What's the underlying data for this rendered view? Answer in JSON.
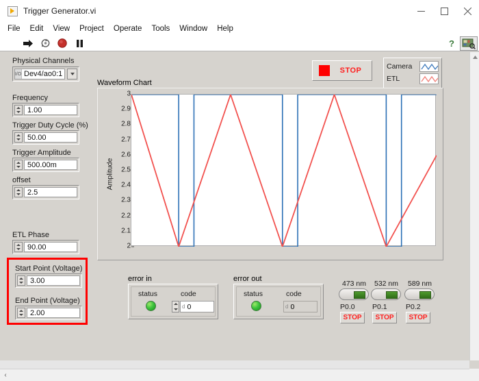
{
  "window": {
    "title": "Trigger Generator.vi",
    "icon": "vi-front-panel-icon",
    "minimize": "─",
    "maximize": "□",
    "close": "✕"
  },
  "menu": {
    "items": [
      "File",
      "Edit",
      "View",
      "Project",
      "Operate",
      "Tools",
      "Window",
      "Help"
    ]
  },
  "toolbar": {
    "buttons": [
      {
        "name": "run-button",
        "icon": "right-arrow-icon"
      },
      {
        "name": "run-continuously-button",
        "icon": "circular-arrows-icon"
      },
      {
        "name": "abort-execution-button",
        "icon": "stop-circle-icon"
      },
      {
        "name": "pause-button",
        "icon": "pause-icon"
      }
    ],
    "help_glyph": "?",
    "search_icon": "search-panel-icon"
  },
  "controls": {
    "physical_channels": {
      "label": "Physical Channels",
      "value": "Dev4/ao0:1",
      "glyph": "io-name-icon"
    },
    "frequency": {
      "label": "Frequency",
      "value": "1.00"
    },
    "duty_cycle": {
      "label": "Trigger Duty Cycle (%)",
      "value": "50.00"
    },
    "amplitude": {
      "label": "Trigger Amplitude",
      "value": "500.00m"
    },
    "offset": {
      "label": "offset",
      "value": "2.5"
    },
    "etl_phase": {
      "label": "ETL Phase",
      "value": "90.00"
    },
    "start_point": {
      "label": "Start Point (Voltage)",
      "value": "3.00"
    },
    "end_point": {
      "label": "End Point (Voltage)",
      "value": "2.00"
    }
  },
  "stop_button": {
    "label": "STOP",
    "color": "#ff2020",
    "indicator_color": "#ff0000"
  },
  "chart": {
    "title": "Waveform Chart",
    "legend": [
      {
        "name": "Camera",
        "color": "#2a6fb5"
      },
      {
        "name": "ETL",
        "color": "#f2514e"
      }
    ]
  },
  "chart_data": {
    "type": "line",
    "title": "Waveform Chart",
    "xlabel": "",
    "ylabel": "Amplitude",
    "ylim": [
      2,
      3
    ],
    "yticks": [
      3,
      2.9,
      2.8,
      2.7,
      2.6,
      2.5,
      2.4,
      2.3,
      2.2,
      2.1,
      2
    ],
    "ytick_labels": [
      "3",
      "2.9",
      "2.8",
      "2.7",
      "2.6",
      "2.5",
      "2.4",
      "2.3",
      "2.2",
      "2.1",
      "2"
    ],
    "xlim": [
      0,
      100
    ],
    "xticks": [],
    "grid": false,
    "legend_position": "outside-top-right",
    "series": [
      {
        "name": "Camera",
        "color": "#2a6fb5",
        "type": "square",
        "description": "Camera trigger square wave, high at 3 V, drops to 2 V at each ETL trough",
        "points": [
          [
            0,
            3
          ],
          [
            15.5,
            3
          ],
          [
            15.5,
            2
          ],
          [
            20.5,
            2
          ],
          [
            20.5,
            3
          ],
          [
            49.5,
            3
          ],
          [
            49.5,
            2
          ],
          [
            54.5,
            2
          ],
          [
            54.5,
            3
          ],
          [
            83.5,
            3
          ],
          [
            83.5,
            2
          ],
          [
            88.5,
            2
          ],
          [
            88.5,
            3
          ],
          [
            100,
            3
          ]
        ]
      },
      {
        "name": "ETL",
        "color": "#f2514e",
        "type": "triangle",
        "description": "ETL triangle ramp sweeping between start 3 V and end 2 V",
        "points": [
          [
            0,
            3
          ],
          [
            15.5,
            2
          ],
          [
            32.5,
            3
          ],
          [
            49.5,
            2
          ],
          [
            66.5,
            3
          ],
          [
            83.5,
            2
          ],
          [
            100,
            2.6
          ]
        ]
      }
    ]
  },
  "error_in": {
    "label": "error in",
    "status_label": "status",
    "code_label": "code",
    "code_value": "0",
    "radix": "d",
    "status_color": "#3ec43e"
  },
  "error_out": {
    "label": "error out",
    "status_label": "status",
    "code_label": "code",
    "code_value": "0",
    "radix": "d",
    "status_color": "#3ec43e"
  },
  "lasers": [
    {
      "wavelength": "473 nm",
      "line": "P0.0",
      "stop_label": "STOP",
      "toggle_state": "on"
    },
    {
      "wavelength": "532 nm",
      "line": "P0.1",
      "stop_label": "STOP",
      "toggle_state": "on"
    },
    {
      "wavelength": "589 nm",
      "line": "P0.2",
      "stop_label": "STOP",
      "toggle_state": "on"
    }
  ],
  "annotation": {
    "color": "#ff0000",
    "target": "start-and-end-point-controls"
  },
  "scrollbars": {
    "left_arrow": "‹",
    "right_arrow": "›",
    "up_arrow": "▴"
  }
}
